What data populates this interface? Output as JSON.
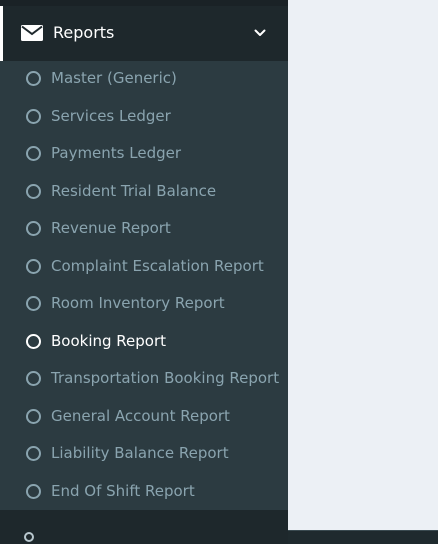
{
  "sidebar": {
    "menu": {
      "label": "Reports",
      "icon": "envelope-icon",
      "expand_icon": "chevron-down-icon",
      "items": [
        {
          "label": "Master (Generic)",
          "active": false
        },
        {
          "label": "Services Ledger",
          "active": false
        },
        {
          "label": "Payments Ledger",
          "active": false
        },
        {
          "label": "Resident Trial Balance",
          "active": false
        },
        {
          "label": "Revenue Report",
          "active": false
        },
        {
          "label": "Complaint Escalation Report",
          "active": false
        },
        {
          "label": "Room Inventory Report",
          "active": false
        },
        {
          "label": "Booking Report",
          "active": true
        },
        {
          "label": "Transportation Booking Report",
          "active": false
        },
        {
          "label": "General Account Report",
          "active": false
        },
        {
          "label": "Liability Balance Report",
          "active": false
        },
        {
          "label": "End Of Shift Report",
          "active": false
        }
      ]
    }
  },
  "colors": {
    "sidebar_bg": "#222d32",
    "submenu_bg": "#2c3b41",
    "header_bg": "#1e282c",
    "item_text": "#8aa4af",
    "active_text": "#ffffff",
    "content_bg": "#ecf0f5"
  }
}
